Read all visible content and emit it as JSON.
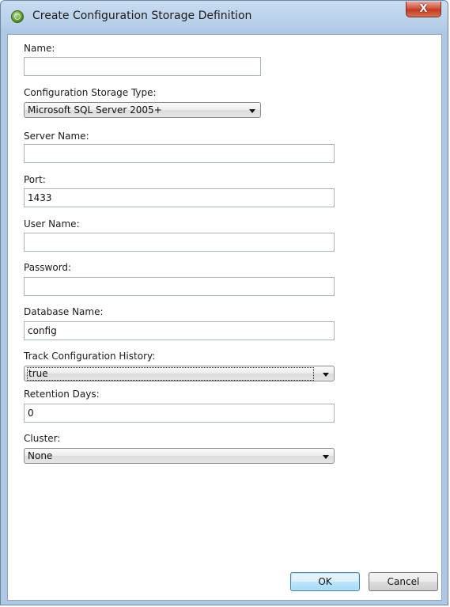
{
  "window": {
    "title": "Create Configuration Storage Definition",
    "close_label": "X",
    "icon": "app-globe-icon"
  },
  "form": {
    "name": {
      "label": "Name:",
      "value": ""
    },
    "storage_type": {
      "label": "Configuration Storage Type:",
      "selected": "Microsoft SQL Server 2005+"
    },
    "server_name": {
      "label": "Server Name:",
      "value": ""
    },
    "port": {
      "label": "Port:",
      "value": "1433"
    },
    "user_name": {
      "label": "User Name:",
      "value": ""
    },
    "password": {
      "label": "Password:",
      "value": ""
    },
    "database_name": {
      "label": "Database Name:",
      "value": "config"
    },
    "track_history": {
      "label": "Track Configuration History:",
      "selected": "true"
    },
    "retention_days": {
      "label": "Retention Days:",
      "value": "0"
    },
    "cluster": {
      "label": "Cluster:",
      "selected": "None"
    }
  },
  "buttons": {
    "ok_label": "OK",
    "cancel_label": "Cancel"
  },
  "colors": {
    "title_bar": "#b7cfe9",
    "close_button": "#c23b22",
    "default_button": "#bee6fd"
  }
}
